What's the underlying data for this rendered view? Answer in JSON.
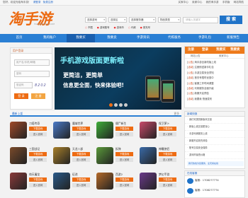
{
  "topbar": {
    "left": [
      "您好，欢迎光临淘手游！",
      "请登录",
      "免费注册"
    ],
    "right": [
      "买家中心",
      "卖家中心",
      "我的淘手游",
      "手机版",
      "网站导航"
    ]
  },
  "logo": {
    "text": "淘手游",
    "sub": "TAOSHOUYOU.COM"
  },
  "search": {
    "selects": [
      "选择游戏",
      "选择区",
      "选择服务器",
      "物品类型"
    ],
    "placeholder": "请输入关键字",
    "button": "搜 索",
    "filters": [
      {
        "label": "不限",
        "hot": false
      },
      {
        "label": "游戏账号",
        "hot": true
      },
      {
        "label": "游戏币",
        "hot": true
      },
      {
        "label": "代练",
        "hot": false
      },
      {
        "label": "首充号",
        "hot": true
      }
    ]
  },
  "nav": {
    "items": [
      "首页",
      "我的账户",
      "我要买",
      "我要卖",
      "手游资讯",
      "代练服务",
      "手游礼包",
      "新服预告"
    ],
    "active_index": 2
  },
  "login": {
    "title": "用户登录",
    "username_placeholder": "用户名/手机/邮箱",
    "password_placeholder": "密码",
    "captcha_placeholder": "验证码",
    "captcha": "8202",
    "login_button": "登 录",
    "register_button": "注 册"
  },
  "banner": {
    "line1": "手机游戏版面更新啦",
    "line2": "更简洁，更简单",
    "line3": "信息更全面，快来体验吧!",
    "slides": 4,
    "active_slide": 1
  },
  "right_box": {
    "tabs": [
      "注册",
      "登录",
      "我要买",
      "我要卖"
    ],
    "sub": [
      "网站公告",
      "卖家中心"
    ],
    "items": [
      {
        "tag": "公告",
        "text": "淘手游全新改版上线"
      },
      {
        "tag": "活动",
        "text": "注册即送新手礼包"
      },
      {
        "tag": "公告",
        "text": "手游交易安全须知"
      },
      {
        "tag": "活动",
        "text": "首充号限时优惠中"
      },
      {
        "tag": "公告",
        "text": "客服工作时间调整"
      },
      {
        "tag": "活动",
        "text": "代练服务全面升级"
      },
      {
        "tag": "公告",
        "text": "新服开启预告"
      },
      {
        "tag": "活动",
        "text": "我要卖 快速发布"
      }
    ]
  },
  "latest": {
    "title": "最新上架",
    "more": "更多",
    "download_label": "下载游戏",
    "official_label": "进入官网",
    "games": [
      {
        "name": "刀塔传奇",
        "color": "#a04a2a"
      },
      {
        "name": "魔域世界",
        "color": "#4a7ac8"
      },
      {
        "name": "僵尸新生",
        "color": "#3fae3a"
      },
      {
        "name": "保卫萝卜",
        "color": "#c94a6a"
      },
      {
        "name": "三国战记",
        "color": "#7a4a2a"
      },
      {
        "name": "天龙八部",
        "color": "#a8802a"
      },
      {
        "name": "拆弹",
        "color": "#5a9a3a"
      },
      {
        "name": "神雕侠侣",
        "color": "#3a6aa8"
      },
      {
        "name": "倚天屠龙",
        "color": "#8a3a3a"
      },
      {
        "name": "征途",
        "color": "#2a5a8a"
      },
      {
        "name": "西游2",
        "color": "#b56a2a"
      },
      {
        "name": "梦幻手游",
        "color": "#6a3a8a"
      }
    ]
  },
  "news": {
    "title": "新闻快报",
    "items": [
      "我们可提供新版本交易",
      "新版上线交易更省心",
      "手游代练服务上线",
      "新服开启抢先体验",
      "账号交易安全保障",
      "游戏币最低价格"
    ],
    "note": "我们热忱为您服务，全天候在线"
  },
  "service": {
    "title": "在线客服",
    "rows": [
      "客服：1708277774",
      "客服：1708277774"
    ]
  },
  "colors": {
    "accent": "#ee6c13",
    "nav": "#2a7fd4",
    "brand": "#1f73c8"
  }
}
